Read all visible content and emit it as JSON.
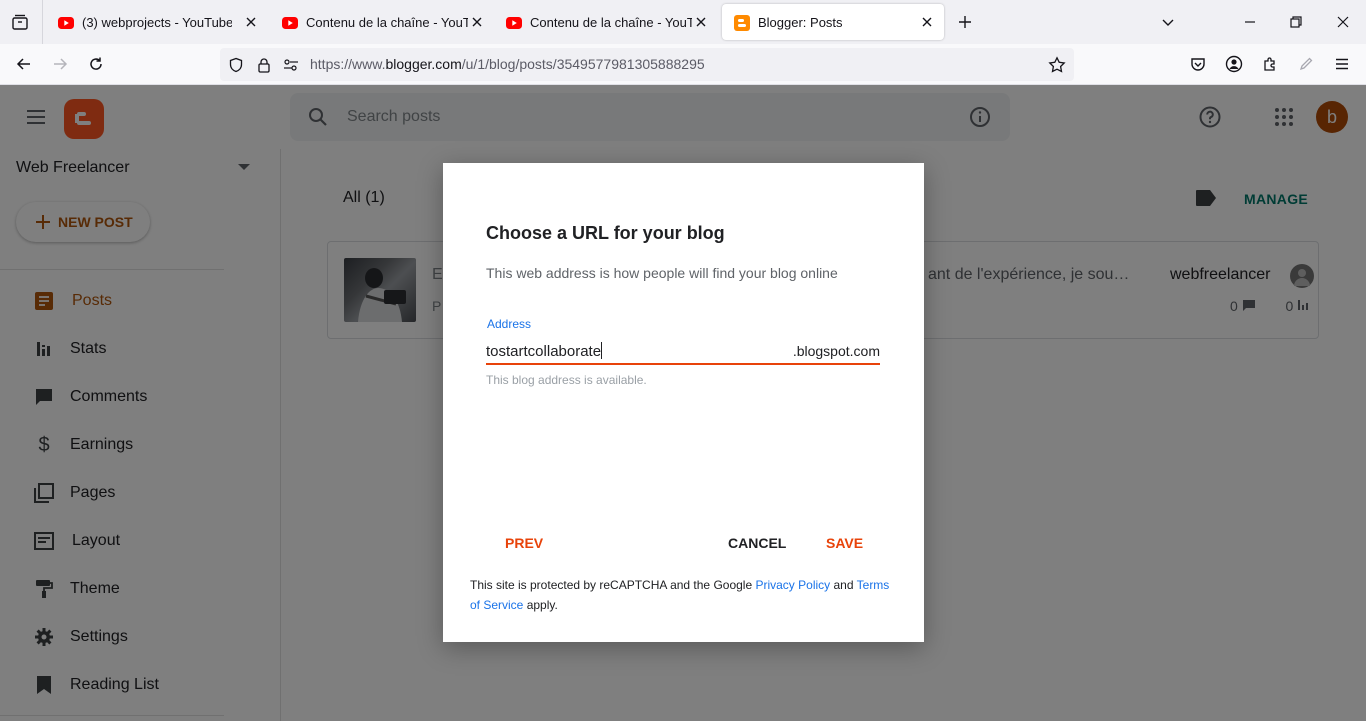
{
  "browser": {
    "tabs": [
      {
        "title": "(3) webprojects - YouTube",
        "favicon": "youtube-icon",
        "active": false
      },
      {
        "title": "Contenu de la chaîne - YouTube",
        "favicon": "youtube-icon",
        "active": false
      },
      {
        "title": "Contenu de la chaîne - YouTube",
        "favicon": "youtube-icon",
        "active": false
      },
      {
        "title": "Blogger: Posts",
        "favicon": "blogger-icon",
        "active": true
      }
    ],
    "url": {
      "scheme": "https://www.",
      "host": "blogger.com",
      "path": "/u/1/blog/posts/3549577981305888295"
    }
  },
  "header": {
    "search_placeholder": "Search posts",
    "avatar_letter": "b"
  },
  "sidebar": {
    "blog_name": "Web Freelancer",
    "new_post_label": "NEW POST",
    "items": [
      {
        "label": "Posts",
        "icon": "posts-icon",
        "active": true
      },
      {
        "label": "Stats",
        "icon": "stats-icon",
        "active": false
      },
      {
        "label": "Comments",
        "icon": "comments-icon",
        "active": false
      },
      {
        "label": "Earnings",
        "icon": "dollar-icon",
        "active": false
      },
      {
        "label": "Pages",
        "icon": "pages-icon",
        "active": false
      },
      {
        "label": "Layout",
        "icon": "layout-icon",
        "active": false
      },
      {
        "label": "Theme",
        "icon": "theme-icon",
        "active": false
      },
      {
        "label": "Settings",
        "icon": "gear-icon",
        "active": false
      },
      {
        "label": "Reading List",
        "icon": "bookmark-icon",
        "active": false
      }
    ]
  },
  "main": {
    "all_label": "All (1)",
    "manage_label": "MANAGE",
    "post": {
      "title_fragment": "E",
      "subtitle_fragment": "P",
      "snippet": "ant de l'expérience, je sou…",
      "author": "webfreelancer",
      "comments": "0",
      "views": "0"
    }
  },
  "dialog": {
    "title": "Choose a URL for your blog",
    "description": "This web address is how people will find your blog online",
    "address_label": "Address",
    "address_value": "tostartcollaborate",
    "address_suffix": ".blogspot.com",
    "address_help": "This blog address is available.",
    "prev_label": "PREV",
    "cancel_label": "CANCEL",
    "save_label": "SAVE",
    "recaptcha_prefix": "This site is protected by reCAPTCHA and the Google ",
    "privacy_label": "Privacy Policy",
    "recaptcha_and": " and ",
    "terms_label": "Terms of Service",
    "recaptcha_suffix": " apply."
  },
  "colors": {
    "blogger_orange": "#ff5722",
    "accent": "#e8430a",
    "link_blue": "#1a73e8",
    "manage_teal": "#00796b"
  }
}
